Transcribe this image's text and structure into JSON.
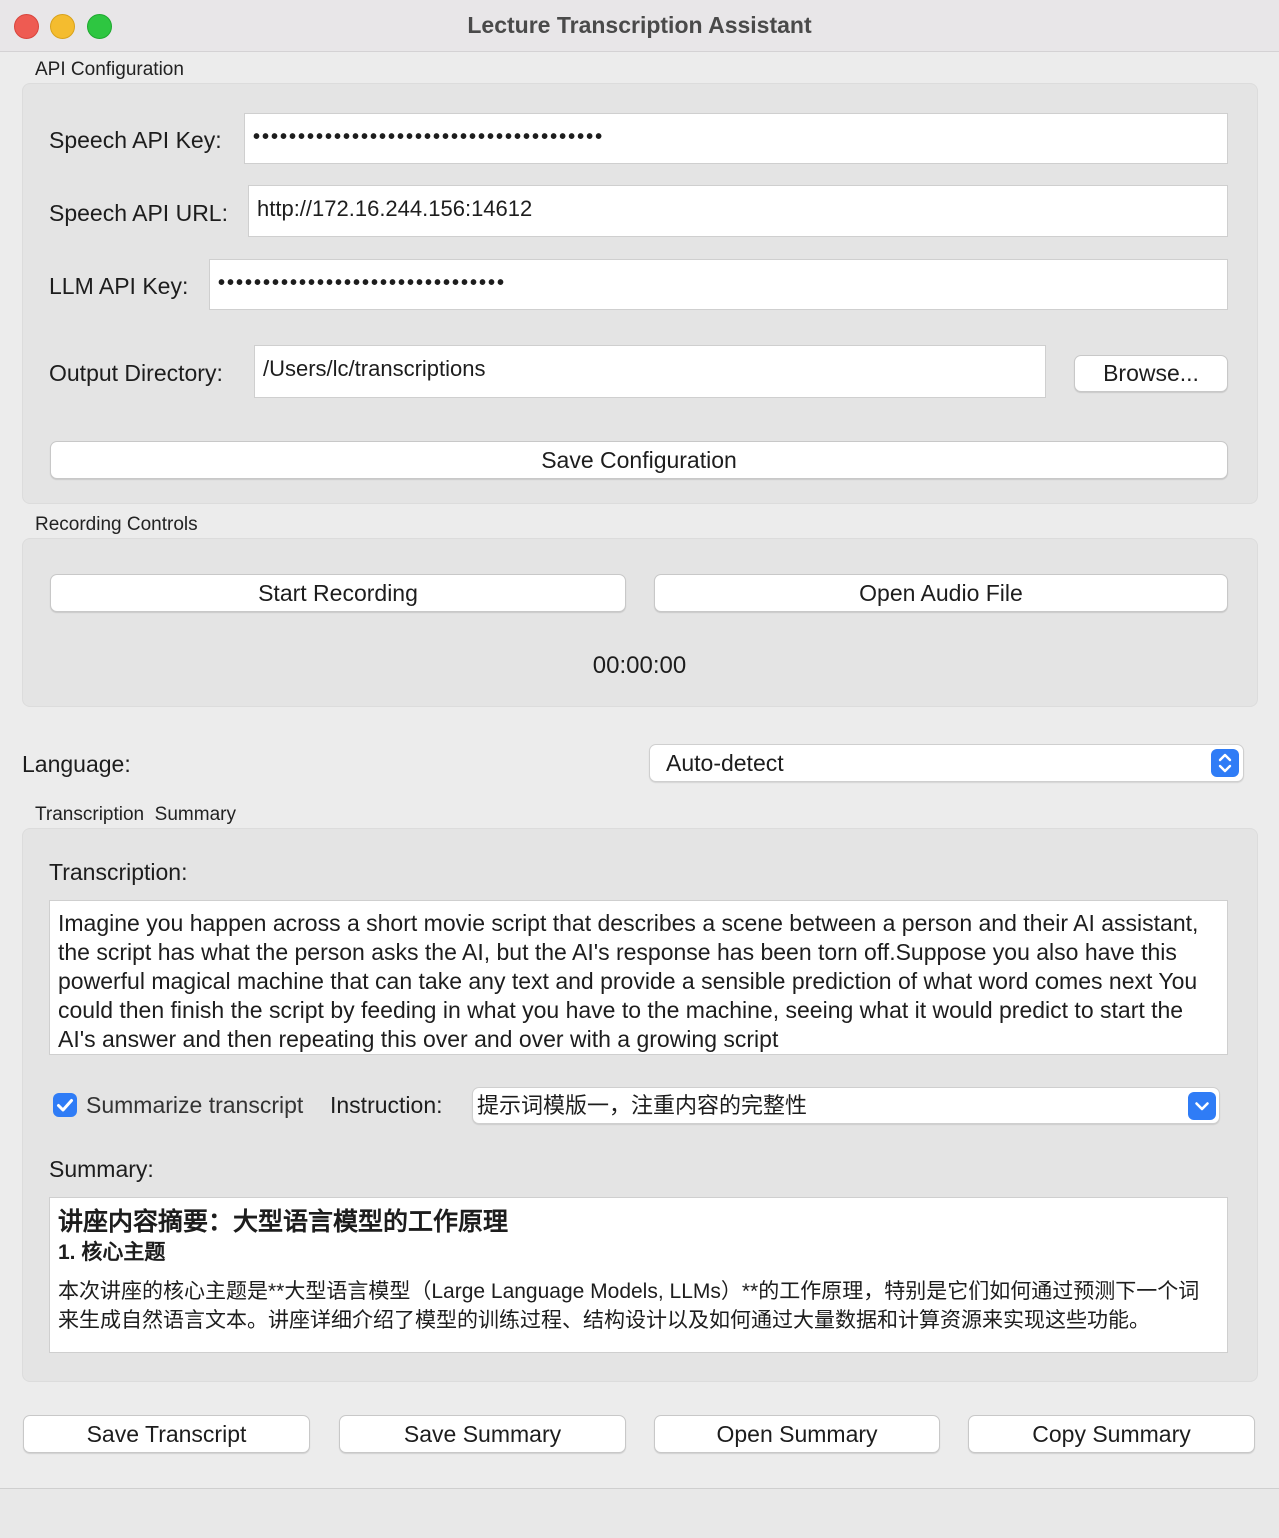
{
  "window": {
    "title": "Lecture Transcription Assistant"
  },
  "api_config": {
    "group_label": "API Configuration",
    "speech_key_label": "Speech API Key:",
    "speech_key_value": "•••••••••••••••••••••••••••••••••••••••",
    "speech_url_label": "Speech API URL:",
    "speech_url_value": "http://172.16.244.156:14612",
    "llm_key_label": "LLM API Key:",
    "llm_key_value": "••••••••••••••••••••••••••••••••",
    "output_dir_label": "Output Directory:",
    "output_dir_value": "/Users/lc/transcriptions",
    "browse_label": "Browse...",
    "save_config_label": "Save Configuration"
  },
  "recording": {
    "group_label": "Recording Controls",
    "start_label": "Start Recording",
    "open_audio_label": "Open Audio File",
    "timer": "00:00:00"
  },
  "language": {
    "label": "Language:",
    "selected": "Auto-detect"
  },
  "transcription_summary": {
    "group_label": "Transcription  Summary",
    "transcription_label": "Transcription:",
    "transcription_text": "Imagine you happen across a short movie script that describes a scene between a person and their AI assistant, the script has what the person asks the AI, but the AI's response has been torn off.Suppose you also have this powerful magical machine that can take any text and provide a sensible prediction of what word comes next You could then finish the script by feeding in what you have to the machine, seeing what it would predict to start the AI's answer and then repeating this over and over with a growing script",
    "summarize_checkbox_label": "Summarize transcript",
    "summarize_checked": true,
    "instruction_label": "Instruction:",
    "instruction_selected": "提示词模版一，注重内容的完整性",
    "summary_label": "Summary:",
    "summary_heading": "讲座内容摘要：大型语言模型的工作原理",
    "summary_subheading": "1. 核心主题",
    "summary_body": "本次讲座的核心主题是**大型语言模型（Large Language Models, LLMs）**的工作原理，特别是它们如何通过预测下一个词来生成自然语言文本。讲座详细介绍了模型的训练过程、结构设计以及如何通过大量数据和计算资源来实现这些功能。"
  },
  "actions": {
    "save_transcript": "Save Transcript",
    "save_summary": "Save Summary",
    "open_summary": "Open Summary",
    "copy_summary": "Copy Summary"
  },
  "colors": {
    "accent": "#2f7cf6",
    "close": "#ee5b52",
    "minimize": "#f4bc2f",
    "maximize": "#2ec641"
  },
  "icons": {
    "close": "close-dot-icon",
    "minimize": "minimize-dot-icon",
    "maximize": "maximize-dot-icon",
    "language_stepper": "up-down-chevron-icon",
    "instruction_dropdown": "chevron-down-icon",
    "checkbox": "checkmark-icon"
  }
}
